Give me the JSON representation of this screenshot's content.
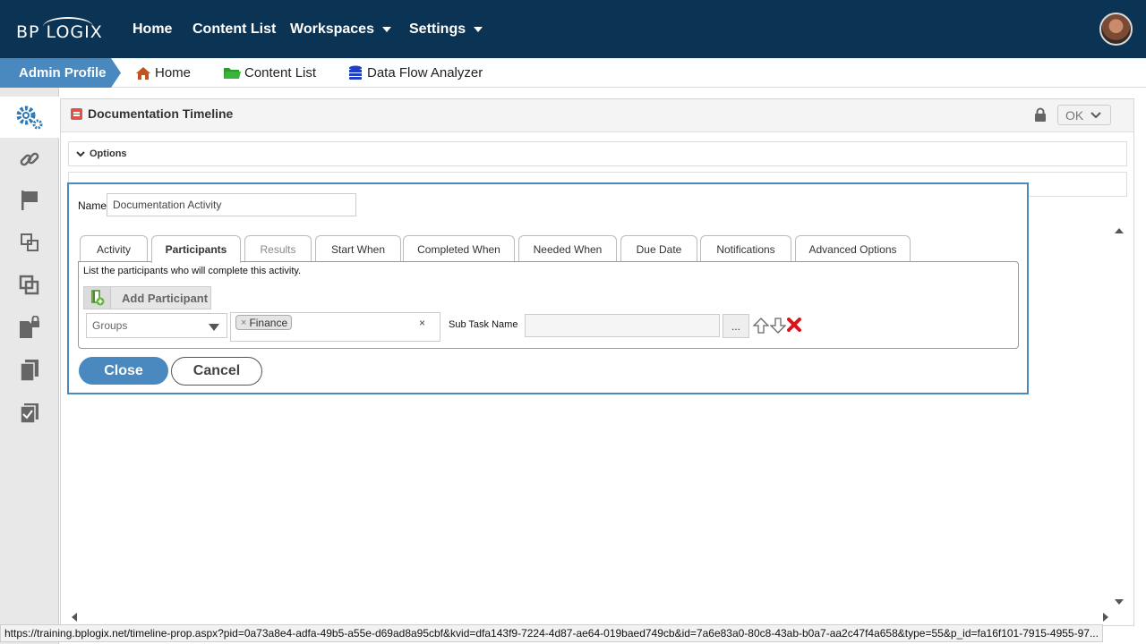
{
  "brand": {
    "logo_text": "BP LOGIX"
  },
  "topnav": {
    "home": "Home",
    "content_list": "Content List",
    "workspaces": "Workspaces",
    "settings": "Settings"
  },
  "subbar": {
    "admin_profile": "Admin Profile",
    "home": "Home",
    "content_list": "Content List",
    "data_flow": "Data Flow Analyzer"
  },
  "sidebar": {
    "items": [
      "gears-icon",
      "link-icon",
      "flag-icon",
      "layers-icon",
      "copy-icon",
      "locked-doc-icon",
      "documents-icon",
      "checklist-icon"
    ]
  },
  "panel": {
    "title": "Documentation Timeline",
    "ok_label": "OK",
    "options_label": "Options"
  },
  "dialog": {
    "name_label": "Name",
    "name_value": "Documentation Activity",
    "tabs": [
      "Activity",
      "Participants",
      "Results",
      "Start When",
      "Completed When",
      "Needed When",
      "Due Date",
      "Notifications",
      "Advanced Options"
    ],
    "active_tab": "Participants",
    "description": "List the participants who will complete this activity.",
    "add_participant": "Add Participant",
    "participant_type": "Groups",
    "selected_tags": [
      "Finance"
    ],
    "tag_remove": "×",
    "clear_all": "×",
    "subtask_label": "Sub Task Name",
    "subtask_value": "",
    "browse_label": "...",
    "close_label": "Close",
    "cancel_label": "Cancel"
  },
  "colors": {
    "navbar": "#0b3353",
    "accent": "#4a88c0",
    "home_icon": "#c0561b",
    "folder_icon": "#2e9a2e",
    "delete_icon": "#d9141b"
  },
  "status_url": "https://training.bplogix.net/timeline-prop.aspx?pid=0a73a8e4-adfa-49b5-a55e-d69ad8a95cbf&kvid=dfa143f9-7224-4d87-ae64-019baed749cb&id=7a6e83a0-80c8-43ab-b0a7-aa2c47f4a658&type=55&p_id=fa16f101-7915-4955-97..."
}
